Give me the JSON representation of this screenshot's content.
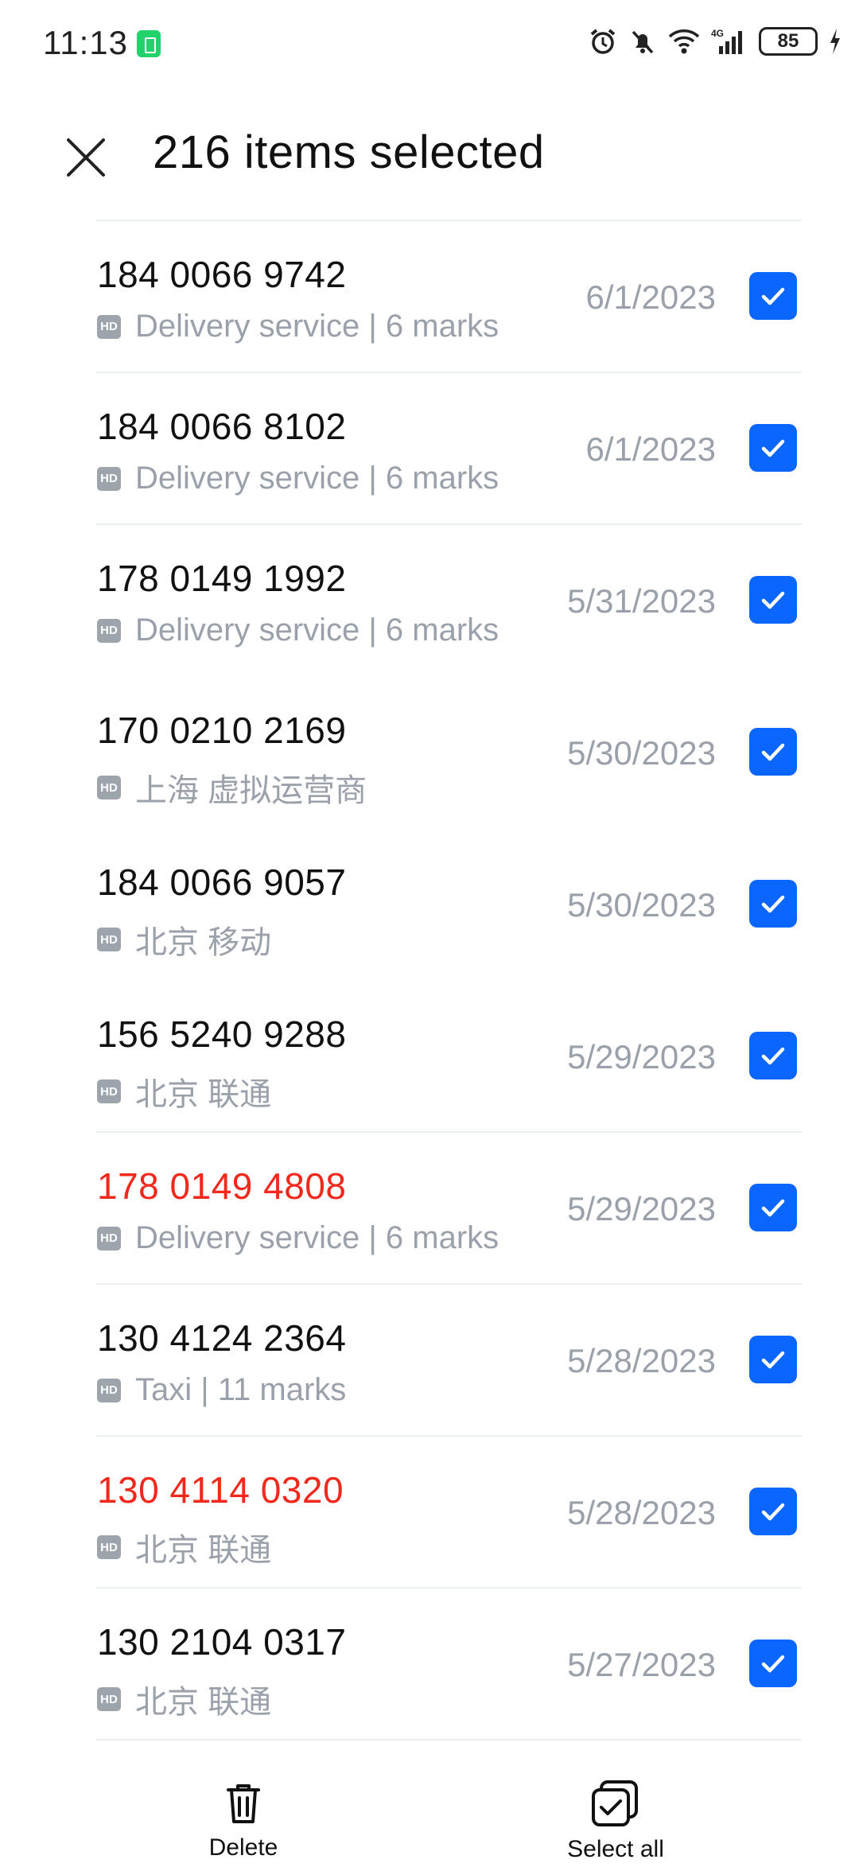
{
  "status_bar": {
    "time": "11:13",
    "network": "4G",
    "battery": "85"
  },
  "header": {
    "title": "216 items selected"
  },
  "calls": [
    {
      "number": "184 0066 9742",
      "info": "Delivery service | 6 marks",
      "date": "6/1/2023",
      "red": false
    },
    {
      "number": "184 0066 8102",
      "info": "Delivery service | 6 marks",
      "date": "6/1/2023",
      "red": false
    },
    {
      "number": "178 0149 1992",
      "info": "Delivery service | 6 marks",
      "date": "5/31/2023",
      "red": false
    },
    {
      "number": "170 0210 2169",
      "info": "上海 虚拟运营商",
      "date": "5/30/2023",
      "red": false
    },
    {
      "number": "184 0066 9057",
      "info": "北京 移动",
      "date": "5/30/2023",
      "red": false
    },
    {
      "number": "156 5240 9288",
      "info": "北京 联通",
      "date": "5/29/2023",
      "red": false
    },
    {
      "number": "178 0149 4808",
      "info": "Delivery service | 6 marks",
      "date": "5/29/2023",
      "red": true
    },
    {
      "number": "130 4124 2364",
      "info": "Taxi | 11 marks",
      "date": "5/28/2023",
      "red": false
    },
    {
      "number": "130 4114 0320",
      "info": "北京 联通",
      "date": "5/28/2023",
      "red": true
    },
    {
      "number": "130 2104 0317",
      "info": "北京 联通",
      "date": "5/27/2023",
      "red": false
    }
  ],
  "hd_badge": "HD",
  "bottom_bar": {
    "delete_label": "Delete",
    "select_all_label": "Select all"
  },
  "colors": {
    "accent": "#0a66ff",
    "missed": "#f0291c",
    "secondary_text": "#9aa1aa"
  }
}
